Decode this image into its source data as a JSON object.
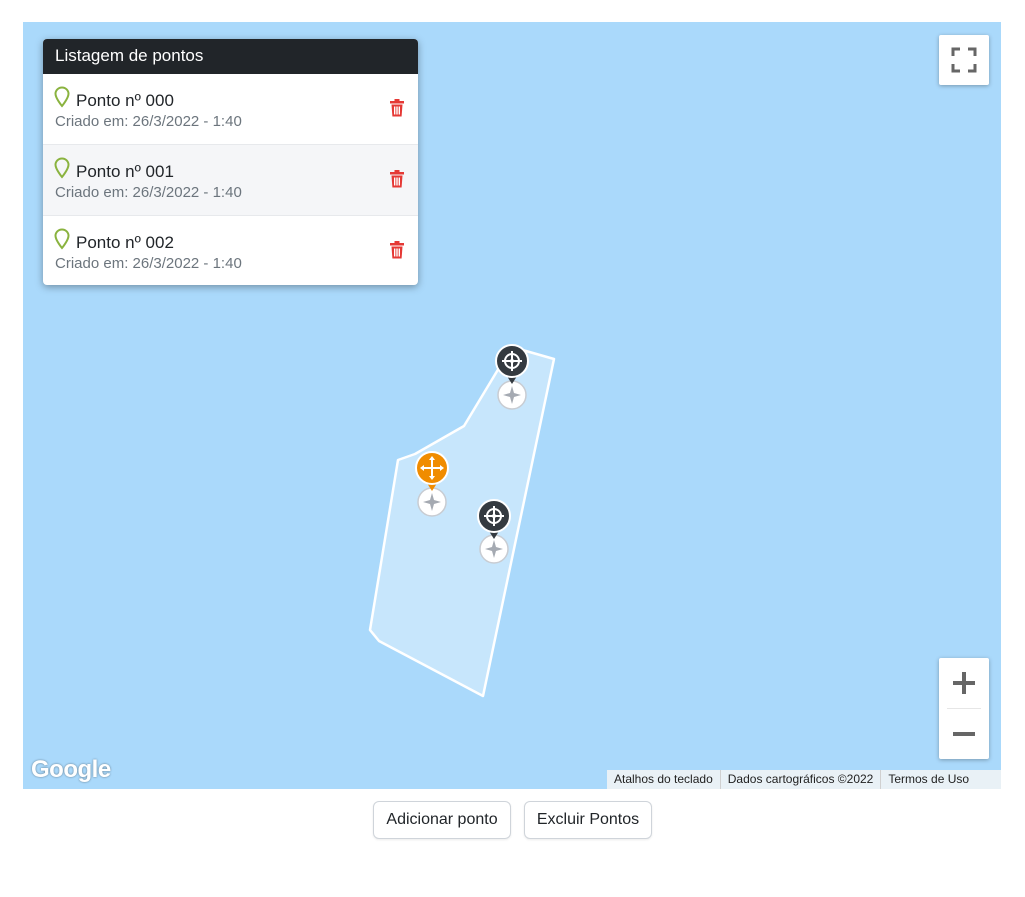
{
  "panel": {
    "title": "Listagem de pontos",
    "items": [
      {
        "label": "Ponto nº 000",
        "created": "Criado em: 26/3/2022 - 1:40"
      },
      {
        "label": "Ponto nº 001",
        "created": "Criado em: 26/3/2022 - 1:40"
      },
      {
        "label": "Ponto nº 002",
        "created": "Criado em: 26/3/2022 - 1:40"
      }
    ]
  },
  "map": {
    "logo": "Google",
    "attribution": {
      "shortcuts": "Atalhos do teclado",
      "data": "Dados cartográficos ©2022",
      "terms": "Termos de Uso"
    },
    "icons": {
      "fullscreen": "fullscreen-icon",
      "zoom_in": "plus-icon",
      "zoom_out": "minus-icon",
      "marker": "crosshair-icon",
      "marker_active": "move-icon",
      "point": "map-pin-icon",
      "delete": "trash-icon"
    }
  },
  "colors": {
    "water": "#aad9fb",
    "polygon_fill": "#cce7fb",
    "marker_dark": "#343a40",
    "marker_active": "#f08c00",
    "pin_green": "#8ab33f",
    "trash_red": "#e53935",
    "header_dark": "#212529"
  },
  "buttons": {
    "add": "Adicionar ponto",
    "delete_all": "Excluir Pontos"
  }
}
